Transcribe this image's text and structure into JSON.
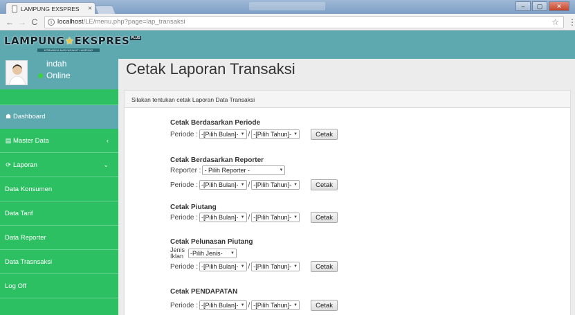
{
  "browser": {
    "tab_title": "LAMPUNG EXSPRES",
    "tab_close": "×",
    "url_host": "localhost",
    "url_path": "/LE/menu.php?page=lap_transaksi",
    "info_glyph": "i",
    "nav": {
      "back": "←",
      "forward": "→",
      "reload": "C"
    },
    "star": "☆",
    "menu_dots": "⋮",
    "window_buttons": {
      "minimize": "–",
      "maximize": "▢",
      "close": "✕"
    }
  },
  "header": {
    "logo_text_1": "LAMPUNG",
    "logo_star": "★",
    "logo_text_2": "EKSPRES",
    "logo_plus": "PLUS",
    "logo_sub": "KORANNYA MASYARAKAT LAMPUNG"
  },
  "user": {
    "name": "indah",
    "status": "Online"
  },
  "sidebar": {
    "items": [
      {
        "icon": "☗",
        "label": "Dashboard",
        "icon_name": "dashboard-icon"
      },
      {
        "icon": "▤",
        "label": "Master Data",
        "chevron": "‹",
        "icon_name": "table-icon"
      },
      {
        "icon": "⟳",
        "label": "Laporan",
        "chevron": "⌄",
        "icon_name": "refresh-icon"
      },
      {
        "label": "Data Konsumen"
      },
      {
        "label": "Data Tarif"
      },
      {
        "label": "Data Reporter"
      },
      {
        "label": "Data Trasnsaksi"
      },
      {
        "label": "Log Off"
      }
    ]
  },
  "main": {
    "title": "Cetak Laporan Transaksi",
    "panel_heading": "Silakan tentukan cetak Laporan Data Transaksi",
    "periode_label": "Periode :",
    "bulan_placeholder": "-[Pilih Bulan]-",
    "tahun_placeholder": "-[Pilih Tahun]-",
    "slash": "/",
    "cetak_label": "Cetak",
    "dropdown_arrow": "▼",
    "sections": {
      "periode": {
        "title": "Cetak Berdasarkan Periode"
      },
      "reporter": {
        "title": "Cetak Berdasarkan Reporter",
        "reporter_label": "Reporter :",
        "reporter_placeholder": "- Pilih Reporter -"
      },
      "piutang": {
        "title": "Cetak Piutang"
      },
      "pelunasan": {
        "title": "Cetak Pelunasan Piutang",
        "jenis_label": "Jenis Iklan",
        "jenis_placeholder": "-Pilih Jenis-"
      },
      "pendapatan": {
        "title": "Cetak PENDAPATAN"
      }
    }
  },
  "colors": {
    "teal": "#5ea8b0",
    "green": "#2cc063"
  }
}
